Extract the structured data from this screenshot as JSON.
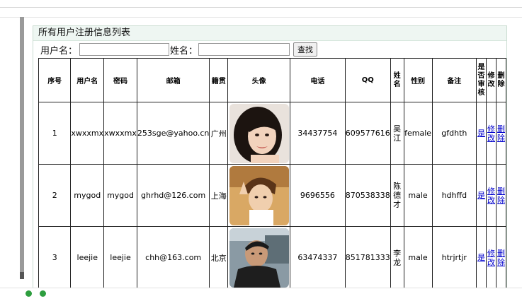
{
  "page": {
    "title": "所有用户注册信息列表"
  },
  "search": {
    "username_label": "用户名：",
    "name_label": "姓名：",
    "username_value": "",
    "name_value": "",
    "search_button": "查找"
  },
  "table": {
    "headers": {
      "id": "序号",
      "username": "用户名",
      "password": "密码",
      "email": "邮箱",
      "origin": "籍贯",
      "avatar": "头像",
      "phone": "电话",
      "qq": "QQ",
      "name": "姓名",
      "gender": "性别",
      "remark": "备注",
      "reviewed": "是否审核",
      "edit": "修改",
      "delete": "删除"
    },
    "rows": [
      {
        "id": "1",
        "username": "xwxxmx",
        "password": "xwxxmx",
        "email": "253sge@yahoo.cn",
        "origin": "广州",
        "phone": "34437754",
        "qq": "609577616",
        "name": "吴江",
        "gender": "female",
        "remark": "gfdhth",
        "reviewed": "是",
        "edit": "修改",
        "delete": "删除"
      },
      {
        "id": "2",
        "username": "mygod",
        "password": "mygod",
        "email": "ghrhd@126.com",
        "origin": "上海",
        "phone": "9696556",
        "qq": "870538338",
        "name": "陈德才",
        "gender": "male",
        "remark": "hdhffd",
        "reviewed": "是",
        "edit": "修改",
        "delete": "删除"
      },
      {
        "id": "3",
        "username": "leejie",
        "password": "leejie",
        "email": "chh@163.com",
        "origin": "北京",
        "phone": "63474337",
        "qq": "851781333",
        "name": "李龙",
        "gender": "male",
        "remark": "htrjrtjr",
        "reviewed": "是",
        "edit": "修改",
        "delete": "删除"
      }
    ]
  },
  "colors": {
    "link": "#0000cc",
    "panel_header_bg": "#eef6f2",
    "panel_border": "#c9dcd0"
  }
}
